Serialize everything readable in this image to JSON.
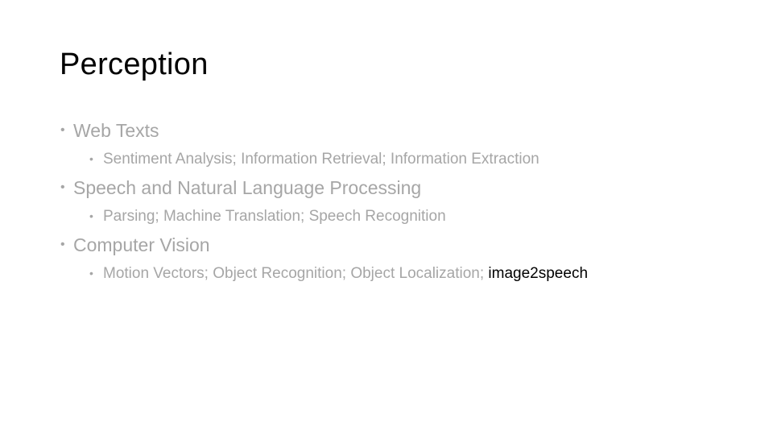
{
  "slide": {
    "title": "Perception",
    "bullet_glyph": "•",
    "colors": {
      "title": "#000000",
      "body": "#a6a6a6",
      "highlight": "#000000"
    },
    "sections": [
      {
        "heading": "Web Texts",
        "items": "Sentiment Analysis; Information Retrieval; Information Extraction"
      },
      {
        "heading": "Speech and Natural Language Processing",
        "items": "Parsing; Machine Translation; Speech Recognition"
      },
      {
        "heading": "Computer Vision",
        "items": "Motion Vectors; Object Recognition; Object Localization; ",
        "highlight": "image2speech"
      }
    ]
  }
}
